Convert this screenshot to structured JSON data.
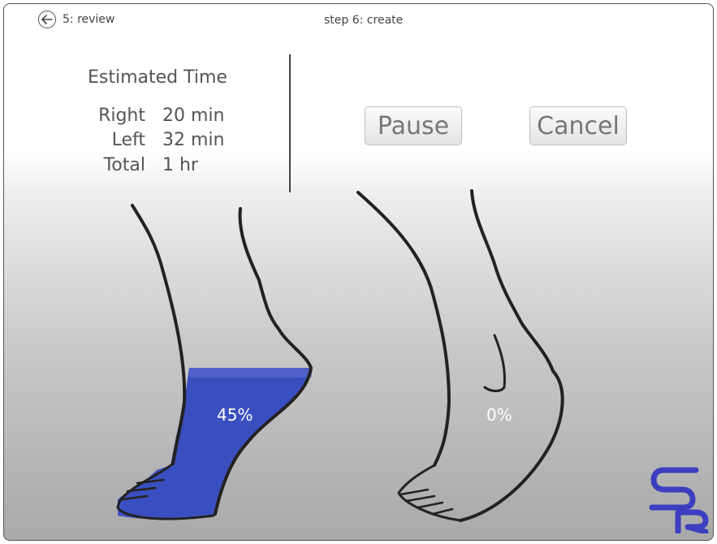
{
  "nav": {
    "back_label": "5: review",
    "step_label": "step 6: create"
  },
  "estimate": {
    "title": "Estimated Time",
    "rows": [
      {
        "label": "Right",
        "value": "20 min"
      },
      {
        "label": "Left",
        "value": "32 min"
      },
      {
        "label": "Total",
        "value": "1 hr"
      }
    ]
  },
  "controls": {
    "pause_label": "Pause",
    "cancel_label": "Cancel"
  },
  "progress": {
    "right_foot_label": "45%",
    "right_foot_value": 0.45,
    "left_foot_label": "0%",
    "left_foot_value": 0.0,
    "fill_color": "#3a4fbf"
  },
  "logo": {
    "text": "SR",
    "color": "#3b3fbf"
  },
  "icons": {
    "back": "arrow-left-icon"
  }
}
